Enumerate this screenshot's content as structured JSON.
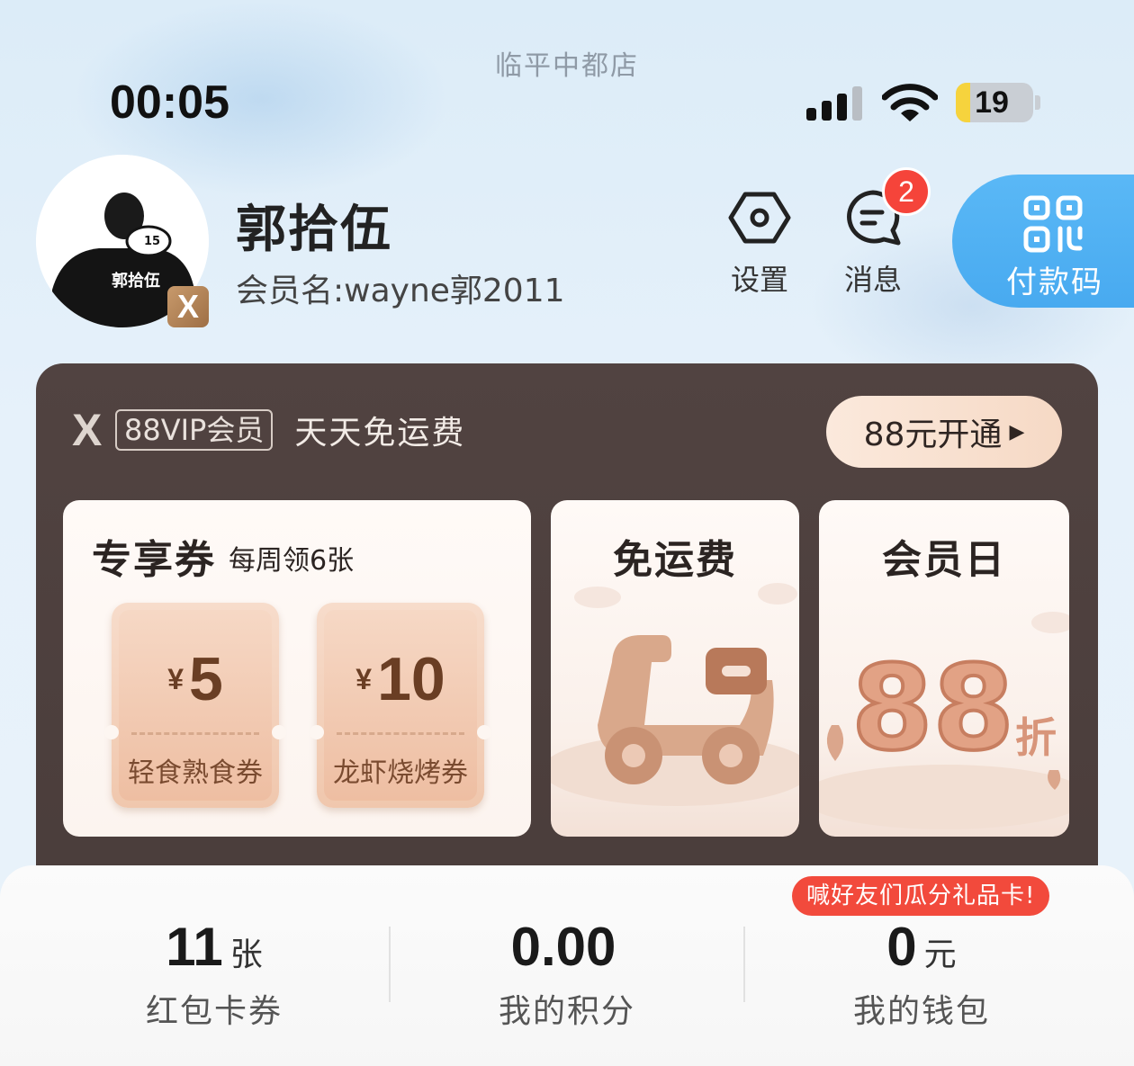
{
  "status_bar": {
    "store_name": "临平中都店",
    "time": "00:05",
    "battery": "19"
  },
  "profile": {
    "avatar_text": "郭拾伍",
    "avatar_number": "15",
    "badge": "X",
    "name": "郭拾伍",
    "member_id": "会员名:wayne郭2011"
  },
  "actions": {
    "settings": "设置",
    "messages": "消息",
    "message_count": "2",
    "pay_code": "付款码"
  },
  "vip": {
    "logo": "X",
    "tag": "88VIP会员",
    "slogan": "天天免运费",
    "cta": "88元开通",
    "tiles": {
      "coupons": {
        "title": "专享券",
        "subtitle": "每周领6张",
        "items": [
          {
            "currency": "¥",
            "amount": "5",
            "name": "轻食熟食券"
          },
          {
            "currency": "¥",
            "amount": "10",
            "name": "龙虾烧烤券"
          }
        ]
      },
      "free_shipping": {
        "title": "免运费"
      },
      "member_day": {
        "title": "会员日",
        "number": "88",
        "unit": "折"
      }
    }
  },
  "stats": [
    {
      "value": "11",
      "unit": "张",
      "label": "红包卡券"
    },
    {
      "value": "0.00",
      "unit": "",
      "label": "我的积分"
    },
    {
      "value": "0",
      "unit": "元",
      "label": "我的钱包"
    }
  ],
  "promo": "喊好友们瓜分礼品卡!",
  "colors": {
    "pay_code_blue": "#48aaf0",
    "badge_red": "#f5443a",
    "vip_dark": "#4a3d3b",
    "coupon_peach": "#f0c7ad"
  }
}
